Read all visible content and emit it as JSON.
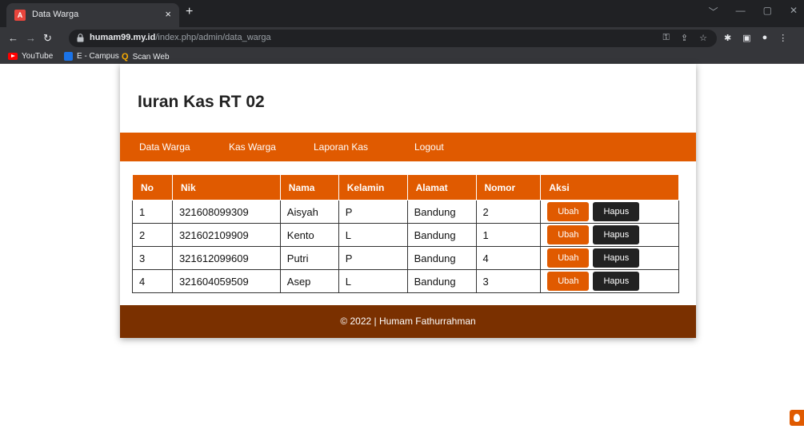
{
  "browser": {
    "tab_title": "Data Warga",
    "tab_close": "×",
    "new_tab": "+",
    "url_host": "humam99.my.id",
    "url_path": "/index.php/admin/data_warga",
    "window_controls": [
      "﹀",
      "—",
      "▢",
      "✕"
    ],
    "bookmarks": [
      {
        "label": "YouTube",
        "icon": "youtube-icon"
      },
      {
        "label": "E - Campus",
        "icon": "ecampus-icon"
      },
      {
        "label": "Scan Web",
        "icon": "search-icon"
      }
    ]
  },
  "page": {
    "title": "Iuran Kas RT 02",
    "nav": [
      "Data Warga",
      "Kas Warga",
      "Laporan Kas",
      "Logout"
    ],
    "table": {
      "headers": [
        "No",
        "Nik",
        "Nama",
        "Kelamin",
        "Alamat",
        "Nomor",
        "Aksi"
      ],
      "rows": [
        [
          "1",
          "321608099309",
          "Aisyah",
          "P",
          "Bandung",
          "2"
        ],
        [
          "2",
          "321602109909",
          "Kento",
          "L",
          "Bandung",
          "1"
        ],
        [
          "3",
          "321612099609",
          "Putri",
          "P",
          "Bandung",
          "4"
        ],
        [
          "4",
          "321604059509",
          "Asep",
          "L",
          "Bandung",
          "3"
        ]
      ],
      "edit_label": "Ubah",
      "delete_label": "Hapus"
    },
    "footer": "© 2022 | Humam Fathurrahman"
  },
  "colors": {
    "accent": "#e05a00",
    "footer": "#7a3000",
    "delete_button": "#222222"
  }
}
